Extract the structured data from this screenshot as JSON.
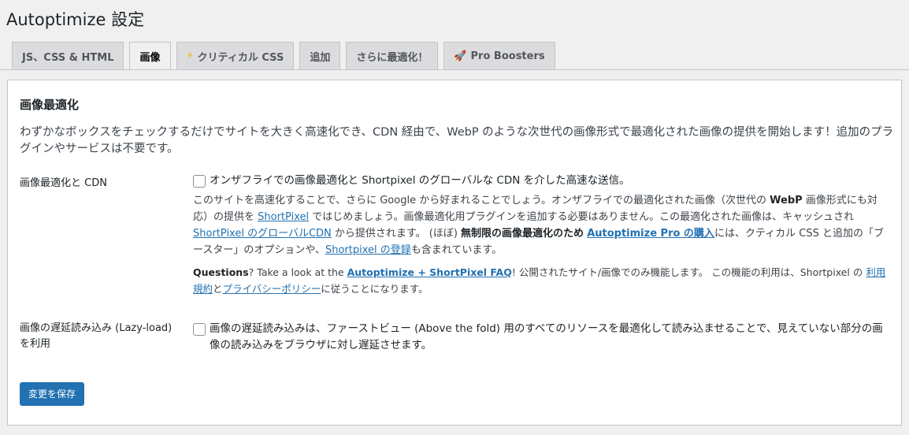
{
  "page_title": "Autoptimize 設定",
  "tabs": [
    {
      "label": "JS、CSS & HTML",
      "icon": ""
    },
    {
      "label": "画像",
      "icon": "",
      "active": true
    },
    {
      "label": "クリティカル CSS",
      "icon": "⚡"
    },
    {
      "label": "追加",
      "icon": ""
    },
    {
      "label": "さらに最適化！",
      "icon": ""
    },
    {
      "label": "Pro Boosters",
      "icon": "🚀"
    }
  ],
  "section": {
    "title": "画像最適化",
    "intro": "わずかなボックスをチェックするだけでサイトを大きく高速化でき、CDN 経由で、WebP のような次世代の画像形式で最適化された画像の提供を開始します！追加のプラグインやサービスは不要です。"
  },
  "row1": {
    "label": "画像最適化と CDN",
    "checkbox_label": "オンザフライでの画像最適化と Shortpixel のグローバルな CDN を介した高速な送信。",
    "desc": {
      "t1": "このサイトを高速化することで、さらに Google から好まれることでしょう。オンザフライでの最適化された画像（次世代の ",
      "b1": "WebP",
      "t2": " 画像形式にも対応）の提供を ",
      "link1": "ShortPixel",
      "t3": " ではじめましょう。画像最適化用プラグインを追加する必要はありません。この最適化された画像は、キャッシュされ ",
      "link2": "ShortPixel のグローバルCDN",
      "t4": " から提供されます。 (ほぼ) ",
      "b2": "無制限の画像最適化のため",
      "t5": " ",
      "link3": "Autoptimize Pro の購入",
      "t6": "には、クティカル CSS と追加の「ブースター」のオプションや、",
      "link4": "Shortpixel の登録",
      "t7": "も含まれています。"
    },
    "desc2": {
      "b1": "Questions",
      "t1": "? Take a look at the ",
      "link1": "Autoptimize + ShortPixel FAQ",
      "t2": "! 公開されたサイト/画像でのみ機能します。 この機能の利用は、Shortpixel の ",
      "link2": "利用規約",
      "t3": "と",
      "link3": "プライバシーポリシー",
      "t4": "に従うことになります。"
    }
  },
  "row2": {
    "label_line1": "画像の遅延読み込み (Lazy-load)",
    "label_line2": "を利用",
    "checkbox_label": "画像の遅延読み込みは、ファーストビュー (Above the fold) 用のすべてのリソースを最適化して読み込ませることで、見えていない部分の画像の読み込みをブラウザに対し遅延させます。"
  },
  "save_button": "変更を保存",
  "colors": {
    "accent": "#2271b1",
    "background": "#f0f0f1",
    "panel": "#ffffff"
  }
}
